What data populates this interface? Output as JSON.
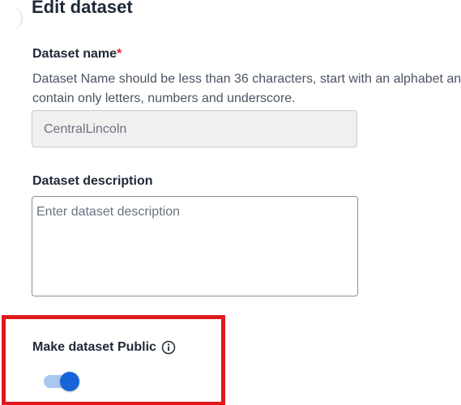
{
  "form": {
    "title": "Edit dataset",
    "name_label": "Dataset name",
    "name_required_marker": "*",
    "name_help": "Dataset Name should be less than 36 characters, start with an alphabet and contain only letters, numbers and underscore.",
    "name_value": "CentralLincoln",
    "description_label": "Dataset description",
    "description_placeholder": "Enter dataset description",
    "description_value": "",
    "public_label": "Make dataset Public",
    "public_info_icon": "info-circle-icon",
    "public_enabled": true
  },
  "colors": {
    "highlight_border": "#e0191f",
    "toggle_on": "#1565d8",
    "toggle_track": "#a8c8f0",
    "required_marker": "#dc2626"
  }
}
